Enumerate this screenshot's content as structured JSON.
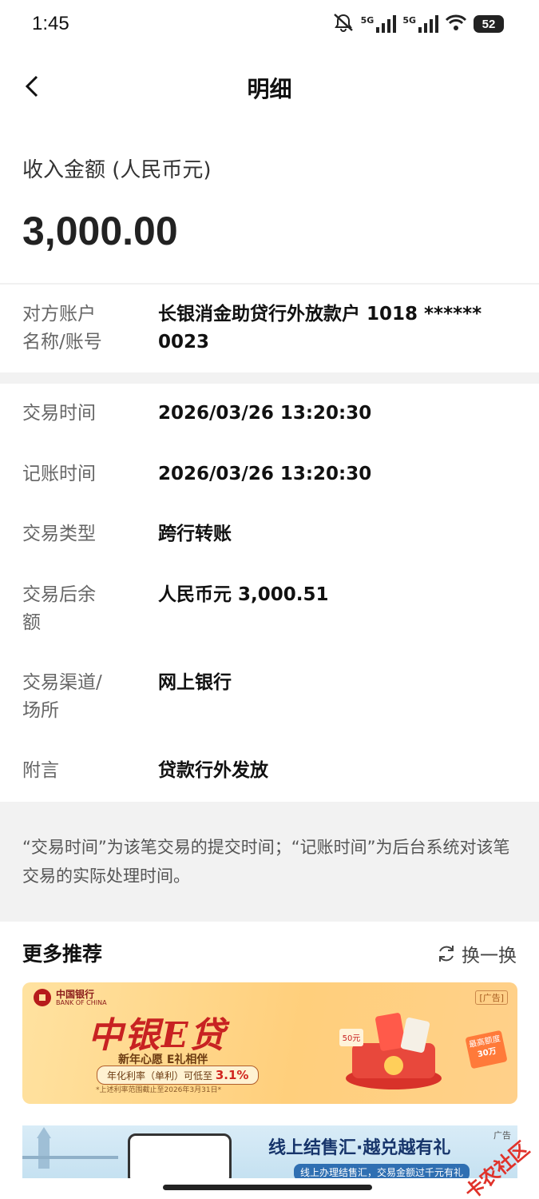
{
  "status": {
    "time": "1:45",
    "battery": "52",
    "network1": "5G",
    "network2": "5G"
  },
  "nav": {
    "title": "明细"
  },
  "amount": {
    "label": "收入金额 (人民币元)",
    "value": "3,000.00"
  },
  "counterparty": {
    "label_line1": "对方账户",
    "label_line2": "名称/账号",
    "value_line1": "长银消金助贷行外放款户 1018 ******",
    "value_line2": "0023"
  },
  "details": [
    {
      "label": "交易时间",
      "value": "2026/03/26 13:20:30"
    },
    {
      "label": "记账时间",
      "value": "2026/03/26 13:20:30"
    },
    {
      "label": "交易类型",
      "value": "跨行转账"
    },
    {
      "label_line1": "交易后余",
      "label_line2": "额",
      "value": "人民币元 3,000.51"
    },
    {
      "label_line1": "交易渠道/",
      "label_line2": "场所",
      "value": "网上银行"
    },
    {
      "label": "附言",
      "value": "贷款行外发放"
    }
  ],
  "note": "“交易时间”为该笔交易的提交时间；“记账时间”为后台系统对该笔交易的实际处理时间。",
  "more": {
    "title": "更多推荐",
    "refresh": "换一换"
  },
  "banner1": {
    "bank_name": "中国银行",
    "bank_en": "BANK OF CHINA",
    "ad_tag": "[广告]",
    "headline": "中银E贷",
    "subline": "新年心愿 E礼相伴",
    "rate_prefix": "年化利率（单利）可低至",
    "rate_value": "3.1%",
    "footnote": "*上述利率范围截止至2026年3月31日*",
    "coupon_top": "最高额度",
    "coupon_value": "30万",
    "badge": "50元"
  },
  "banner2": {
    "title": "线上结售汇·越兑越有礼",
    "tag": "广告",
    "sub": "线上办理结售汇，交易金额过千元有礼"
  },
  "watermark": "卡农社区",
  "colors": {
    "accent_red": "#c82222",
    "band_gray": "#f2f2f2"
  }
}
